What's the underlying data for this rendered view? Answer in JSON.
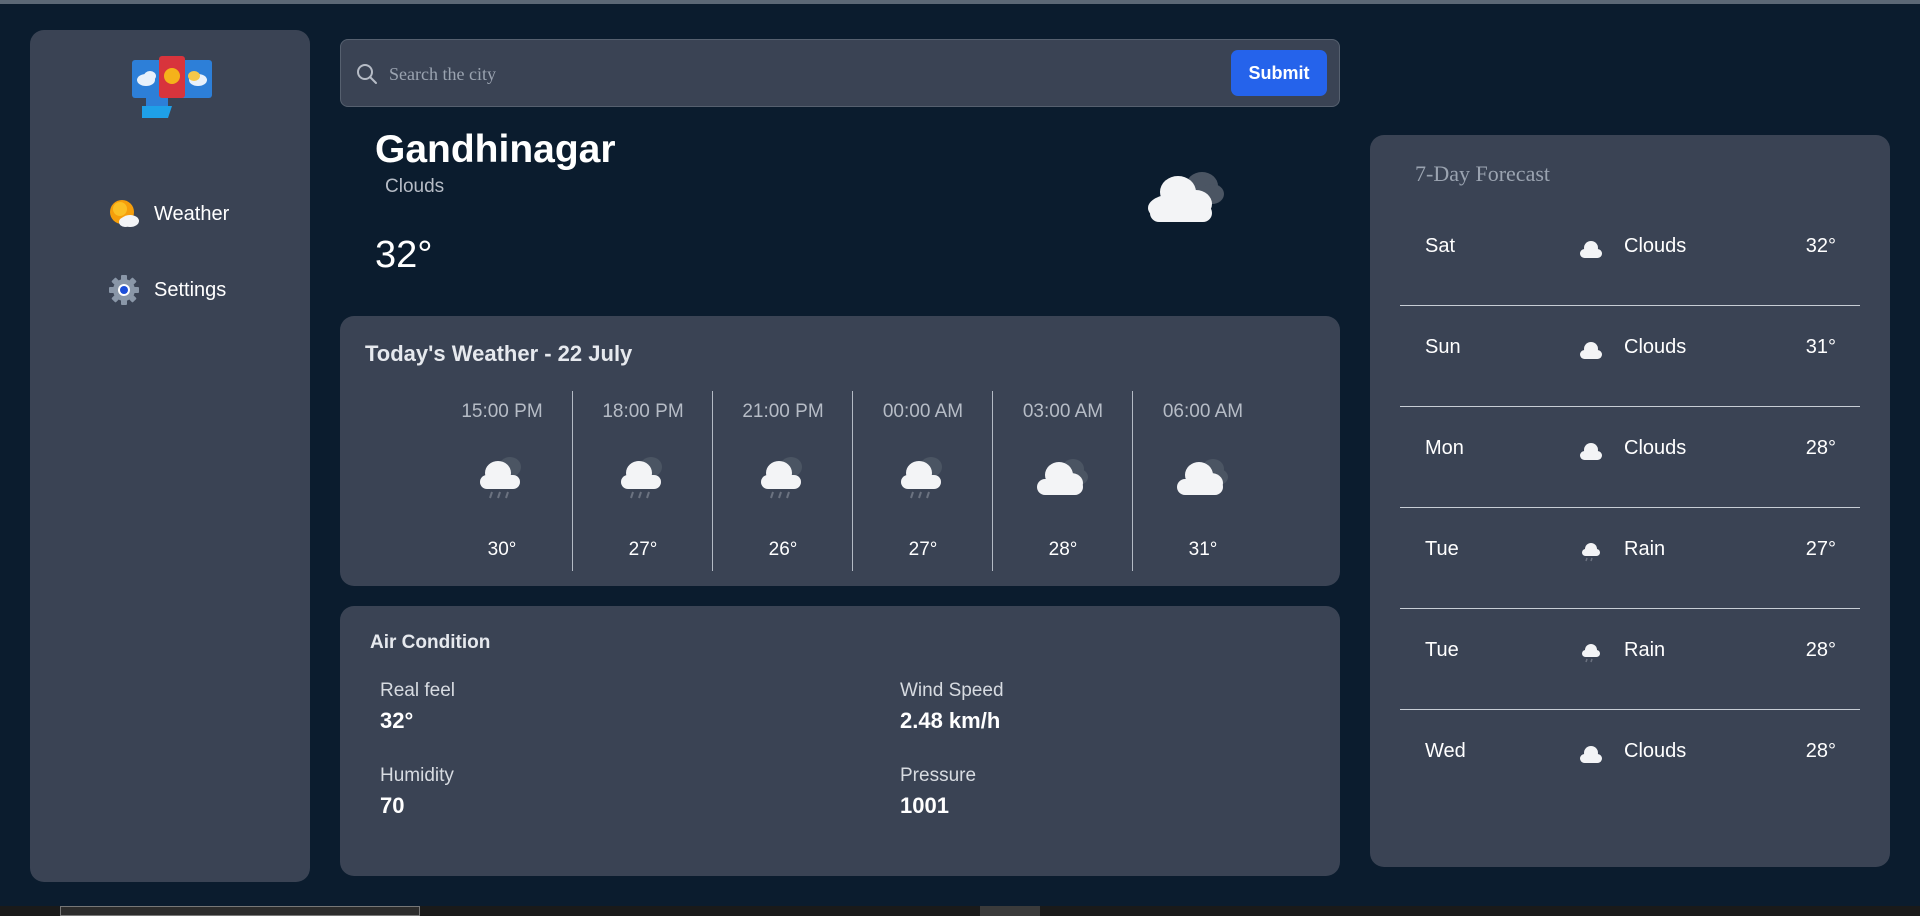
{
  "sidebar": {
    "logo_icon": "weather-app-logo",
    "items": [
      {
        "label": "Weather",
        "icon": "sun-cloud-icon"
      },
      {
        "label": "Settings",
        "icon": "gear-icon"
      }
    ]
  },
  "search": {
    "placeholder": "Search the city",
    "value": "",
    "submit_label": "Submit"
  },
  "current": {
    "city": "Gandhinagar",
    "condition": "Clouds",
    "temperature": "32°",
    "icon": "cloud-icon"
  },
  "today": {
    "title": "Today's Weather - 22 July",
    "hours": [
      {
        "time": "15:00 PM",
        "temp": "30°",
        "icon": "rain-cloud-icon"
      },
      {
        "time": "18:00 PM",
        "temp": "27°",
        "icon": "rain-cloud-icon"
      },
      {
        "time": "21:00 PM",
        "temp": "26°",
        "icon": "rain-cloud-icon"
      },
      {
        "time": "00:00 AM",
        "temp": "27°",
        "icon": "rain-cloud-icon"
      },
      {
        "time": "03:00 AM",
        "temp": "28°",
        "icon": "cloud-icon"
      },
      {
        "time": "06:00 AM",
        "temp": "31°",
        "icon": "cloud-icon"
      }
    ]
  },
  "air": {
    "title": "Air Condition",
    "real_feel": {
      "label": "Real feel",
      "value": "32°"
    },
    "wind_speed": {
      "label": "Wind Speed",
      "value": "2.48 km/h"
    },
    "humidity": {
      "label": "Humidity",
      "value": "70"
    },
    "pressure": {
      "label": "Pressure",
      "value": "1001"
    }
  },
  "forecast": {
    "title": "7-Day Forecast",
    "days": [
      {
        "day": "Sat",
        "condition": "Clouds",
        "temp": "32°",
        "icon": "cloud-icon"
      },
      {
        "day": "Sun",
        "condition": "Clouds",
        "temp": "31°",
        "icon": "cloud-icon"
      },
      {
        "day": "Mon",
        "condition": "Clouds",
        "temp": "28°",
        "icon": "cloud-icon"
      },
      {
        "day": "Tue",
        "condition": "Rain",
        "temp": "27°",
        "icon": "rain-cloud-icon"
      },
      {
        "day": "Tue",
        "condition": "Rain",
        "temp": "28°",
        "icon": "rain-cloud-icon"
      },
      {
        "day": "Wed",
        "condition": "Clouds",
        "temp": "28°",
        "icon": "cloud-icon"
      }
    ]
  },
  "colors": {
    "background": "#0b1c2e",
    "card": "#3a4354",
    "accent": "#2563eb"
  }
}
